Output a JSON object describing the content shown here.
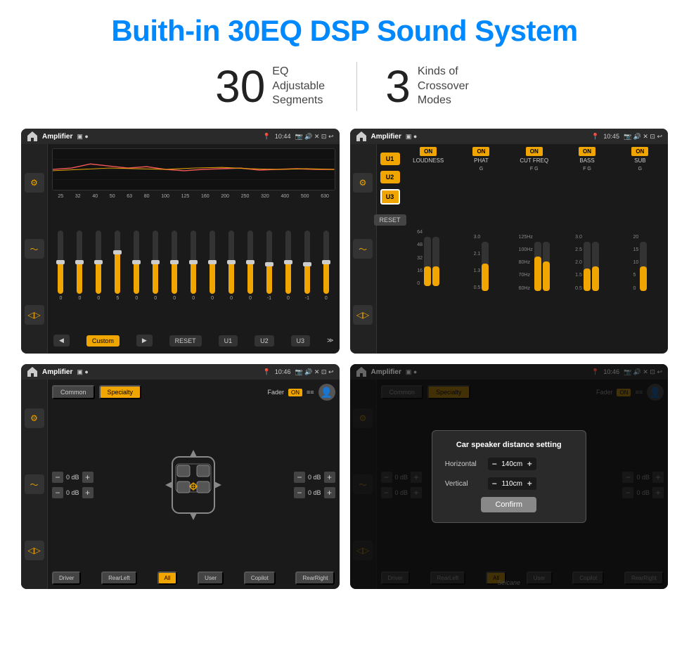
{
  "page": {
    "title": "Buith-in 30EQ DSP Sound System",
    "title_color": "#0088ff"
  },
  "stats": [
    {
      "number": "30",
      "label": "EQ Adjustable\nSegments"
    },
    {
      "number": "3",
      "label": "Kinds of\nCrossover Modes"
    }
  ],
  "screens": {
    "screen1": {
      "title": "Amplifier",
      "time": "10:44",
      "mode": "Custom",
      "freq_labels": [
        "25",
        "32",
        "40",
        "50",
        "63",
        "80",
        "100",
        "125",
        "160",
        "200",
        "250",
        "320",
        "400",
        "500",
        "630"
      ],
      "sliders": [
        0,
        0,
        0,
        5,
        0,
        0,
        0,
        0,
        0,
        0,
        0,
        -1,
        0,
        -1
      ],
      "buttons": [
        "RESET",
        "U1",
        "U2",
        "U3"
      ]
    },
    "screen2": {
      "title": "Amplifier",
      "time": "10:45",
      "channels": [
        "LOUDNESS",
        "PHAT",
        "CUT FREQ",
        "BASS",
        "SUB"
      ],
      "channel_values": [
        "G",
        "G",
        "F G",
        "F G",
        "G"
      ],
      "u_buttons": [
        "U1",
        "U2",
        "U3"
      ],
      "active_u": "U3"
    },
    "screen3": {
      "title": "Amplifier",
      "time": "10:46",
      "tabs": [
        "Common",
        "Specialty"
      ],
      "active_tab": "Specialty",
      "fader_label": "Fader",
      "fader_status": "ON",
      "volume_rows": [
        {
          "value": "0 dB"
        },
        {
          "value": "0 dB"
        },
        {
          "value": "0 dB"
        },
        {
          "value": "0 dB"
        }
      ],
      "zone_buttons": [
        "Driver",
        "RearLeft",
        "All",
        "User",
        "Copilot",
        "RearRight"
      ],
      "active_zone": "All"
    },
    "screen4": {
      "title": "Amplifier",
      "time": "10:46",
      "tabs": [
        "Common",
        "Specialty"
      ],
      "active_tab": "Specialty",
      "fader_status": "ON",
      "dialog": {
        "title": "Car speaker distance setting",
        "fields": [
          {
            "label": "Horizontal",
            "value": "140cm"
          },
          {
            "label": "Vertical",
            "value": "110cm"
          }
        ],
        "confirm_label": "Confirm"
      },
      "zone_buttons": [
        "Driver",
        "RearLeft",
        "All",
        "User",
        "Copilot",
        "RearRight"
      ]
    }
  },
  "watermark": "Seicane"
}
